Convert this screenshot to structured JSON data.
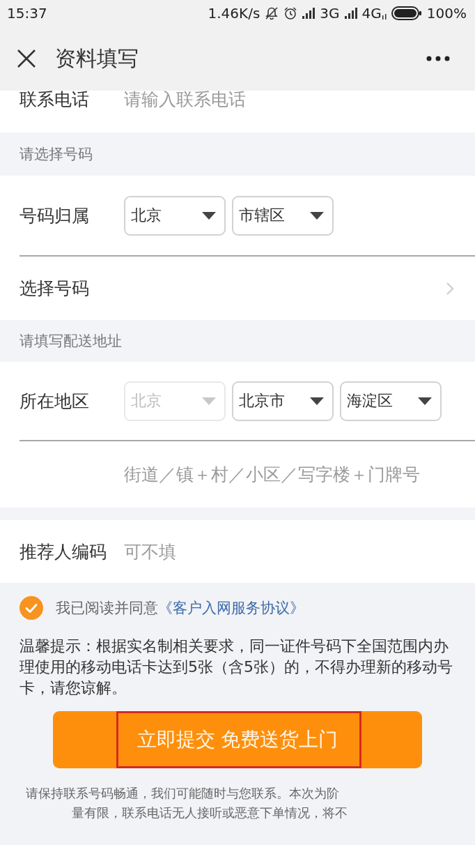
{
  "status_bar": {
    "time": "15:37",
    "speed": "1.46K/s",
    "network_1": "3G",
    "network_2": "4G",
    "battery": "100%"
  },
  "nav_bar": {
    "title": "资料填写"
  },
  "phone_field": {
    "label": "联系电话",
    "placeholder": "请输入联系电话"
  },
  "number_section": {
    "header": "请选择号码",
    "region_label": "号码归属",
    "selects": [
      {
        "value": "北京",
        "disabled": false
      },
      {
        "value": "市辖区",
        "disabled": false
      }
    ],
    "choose_label": "选择号码"
  },
  "address_section": {
    "header": "请填写配送地址",
    "area_label": "所在地区",
    "selects": [
      {
        "value": "北京",
        "disabled": true
      },
      {
        "value": "北京市",
        "disabled": false
      },
      {
        "value": "海淀区",
        "disabled": false
      }
    ],
    "detail_placeholder": "街道／镇＋村／小区／写字楼＋门牌号"
  },
  "referrer_field": {
    "label": "推荐人编码",
    "placeholder": "可不填"
  },
  "agreement": {
    "checked": true,
    "text": "我已阅读并同意",
    "link": "《客户入网服务协议》"
  },
  "notice": "温馨提示：根据实名制相关要求，同一证件号码下全国范围内办理使用的移动电话卡达到5张（含5张）的，不得办理新的移动号卡，请您谅解。",
  "submit_button": {
    "label": "立即提交 免费送货上门",
    "highlighted": true
  },
  "footer_note": {
    "lines": [
      "请保持联系号码畅通，我们可能随时与您联系。本次为阶",
      "量有限，联系电话无人接听或恶意下单情况，将不"
    ]
  }
}
